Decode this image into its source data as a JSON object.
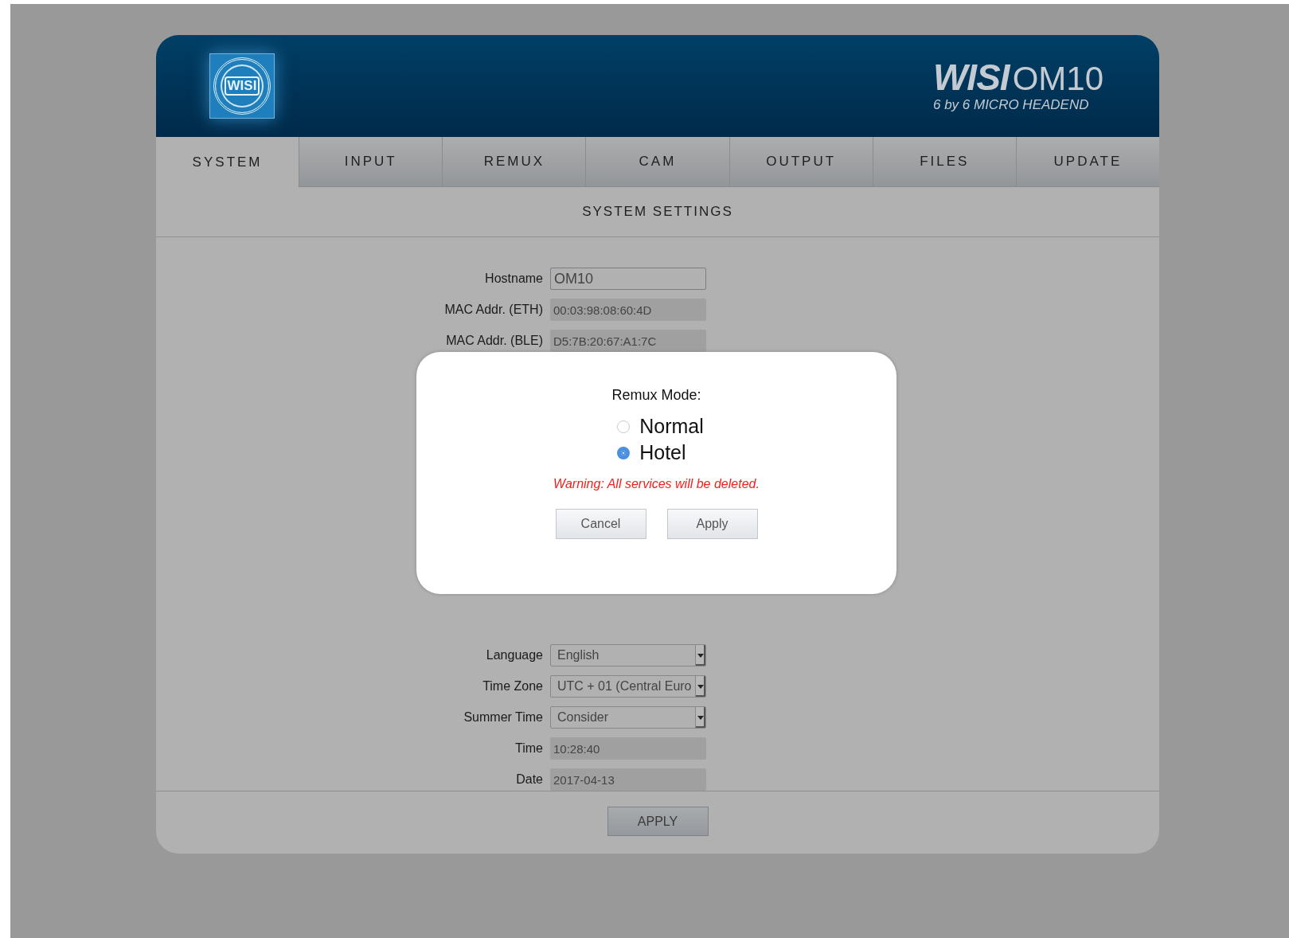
{
  "header": {
    "logo_text": "WISI",
    "brand": "WISI",
    "model": "OM10",
    "subtitle": "6 by 6 MICRO HEADEND"
  },
  "tabs": [
    {
      "label": "SYSTEM",
      "selected": true
    },
    {
      "label": "INPUT",
      "selected": false
    },
    {
      "label": "REMUX",
      "selected": false
    },
    {
      "label": "CAM",
      "selected": false
    },
    {
      "label": "OUTPUT",
      "selected": false
    },
    {
      "label": "FILES",
      "selected": false
    },
    {
      "label": "UPDATE",
      "selected": false
    }
  ],
  "section_title": "SYSTEM SETTINGS",
  "fields_top": [
    {
      "label": "Hostname",
      "value": "OM10",
      "kind": "input"
    },
    {
      "label": "MAC Addr. (ETH)",
      "value": "00:03:98:08:60:4D",
      "kind": "readonly"
    },
    {
      "label": "MAC Addr. (BLE)",
      "value": "D5:7B:20:67:A1:7C",
      "kind": "readonly"
    }
  ],
  "fields_bottom": [
    {
      "label": "Language",
      "value": "English",
      "kind": "select"
    },
    {
      "label": "Time Zone",
      "value": "UTC + 01 (Central Euro",
      "kind": "select"
    },
    {
      "label": "Summer Time",
      "value": "Consider",
      "kind": "select"
    },
    {
      "label": "Time",
      "value": "10:28:40",
      "kind": "readonly"
    },
    {
      "label": "Date",
      "value": "2017-04-13",
      "kind": "readonly"
    }
  ],
  "apply_button": "APPLY",
  "dialog": {
    "title": "Remux Mode:",
    "options": [
      {
        "label": "Normal",
        "selected": false
      },
      {
        "label": "Hotel",
        "selected": true
      }
    ],
    "warning": "Warning: All services will be deleted.",
    "buttons": [
      "Cancel",
      "Apply"
    ]
  }
}
